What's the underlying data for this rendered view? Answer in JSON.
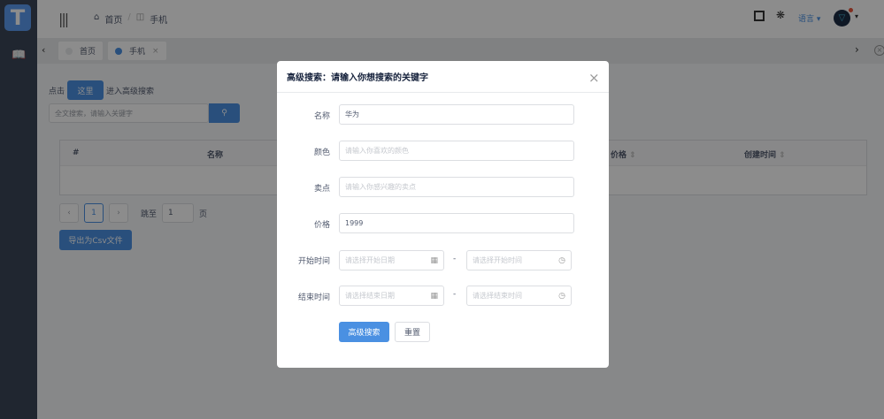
{
  "sidebar": {
    "logo": "T",
    "nav_icon": "book-icon"
  },
  "header": {
    "breadcrumb": [
      "首页",
      "手机"
    ],
    "language": "语言"
  },
  "tabs": [
    {
      "label": "首页"
    },
    {
      "label": "手机"
    }
  ],
  "page": {
    "click_prefix": "点击",
    "here_button": "这里",
    "click_suffix": "进入高级搜索",
    "search_placeholder": "全文搜索，请输入关键字",
    "table_headers": [
      "#",
      "名称",
      "价格",
      "创建时间"
    ],
    "pagination": {
      "current": "1",
      "jump_label": "跳至",
      "jump_value": "1",
      "page_suffix": "页"
    },
    "export_button": "导出为Csv文件"
  },
  "modal": {
    "title": "高级搜索：请输入你想搜索的关键字",
    "fields": [
      {
        "label": "名称",
        "value": "华为"
      },
      {
        "label": "颜色",
        "placeholder": "请输入你喜欢的颜色"
      },
      {
        "label": "卖点",
        "placeholder": "请输入你感兴趣的卖点"
      },
      {
        "label": "价格",
        "value": "1999"
      }
    ],
    "start": {
      "label": "开始时间",
      "date_placeholder": "请选择开始日期",
      "time_placeholder": "请选择开始时间"
    },
    "end": {
      "label": "结束时间",
      "date_placeholder": "请选择结束日期",
      "time_placeholder": "请选择结束时间"
    },
    "separator": "-",
    "search_button": "高级搜索",
    "reset_button": "重置"
  },
  "colors": {
    "primary": "#4a90e2",
    "sidebar": "#3a4658"
  }
}
